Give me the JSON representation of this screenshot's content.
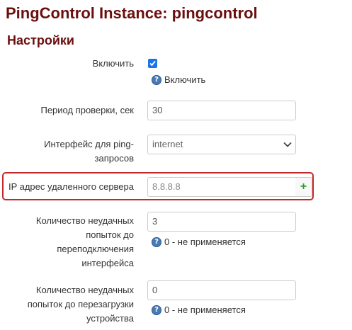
{
  "page": {
    "title": "PingControl Instance: pingcontrol",
    "section_title": "Настройки"
  },
  "form": {
    "enable": {
      "label": "Включить",
      "checked": true,
      "hint": "Включить"
    },
    "period": {
      "label": "Период проверки, сек",
      "value": "30"
    },
    "interface": {
      "label": "Интерфейс для ping-запросов",
      "selected": "internet"
    },
    "remote_ip": {
      "label": "IP адрес удаленного сервера",
      "placeholder": "8.8.8.8",
      "add_label": "+"
    },
    "reconnect_failures": {
      "label": "Количество неудачных попыток до переподключения интерфейса",
      "value": "3",
      "hint": "0 - не применяется"
    },
    "reboot_failures": {
      "label": "Количество неудачных попыток до перезагрузки устройства",
      "value": "0",
      "hint": "0 - не применяется"
    }
  },
  "icons": {
    "help": "question-icon",
    "add": "plus-icon",
    "dropdown": "chevron-down-icon",
    "checkbox": "checkmark-icon"
  },
  "colors": {
    "title": "#6b0e0e",
    "checkbox": "#1a73e8",
    "add_button": "#2e9c2e",
    "highlight": "#c62828",
    "help_icon": "#4a7ab5"
  }
}
